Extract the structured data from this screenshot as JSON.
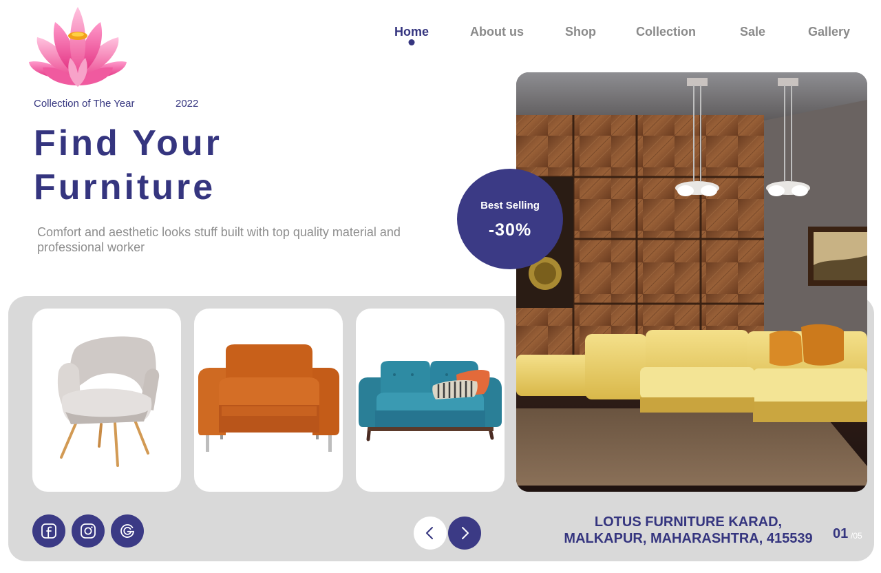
{
  "brand": {
    "logo_icon": "lotus-icon"
  },
  "nav": {
    "items": [
      {
        "label": "Home",
        "active": true
      },
      {
        "label": "About us",
        "active": false
      },
      {
        "label": "Shop",
        "active": false
      },
      {
        "label": "Collection",
        "active": false
      },
      {
        "label": "Sale",
        "active": false
      },
      {
        "label": "Gallery",
        "active": false
      }
    ]
  },
  "hero": {
    "tagline": "Collection of The Year",
    "year": "2022",
    "headline_line1": "Find Your",
    "headline_line2": "Furniture",
    "subtext": "Comfort and aesthetic looks stuff built with top quality material and professional worker"
  },
  "badge": {
    "label": "Best Selling",
    "value": "-30%"
  },
  "products": [
    {
      "name": "armchair-icon"
    },
    {
      "name": "sofa-chair-icon"
    },
    {
      "name": "loveseat-icon"
    }
  ],
  "socials": [
    {
      "icon": "facebook-icon"
    },
    {
      "icon": "instagram-icon"
    },
    {
      "icon": "google-icon"
    }
  ],
  "address": {
    "line1": "LOTUS FURNITURE KARAD,",
    "line2": "MALKAPUR, MAHARASHTRA, 415539"
  },
  "pagination": {
    "current": "01",
    "total": "/05"
  },
  "colors": {
    "accent": "#3b3a85",
    "text_primary": "#35357f",
    "text_muted": "#8a8a8a",
    "panel": "#d9d9d9"
  }
}
